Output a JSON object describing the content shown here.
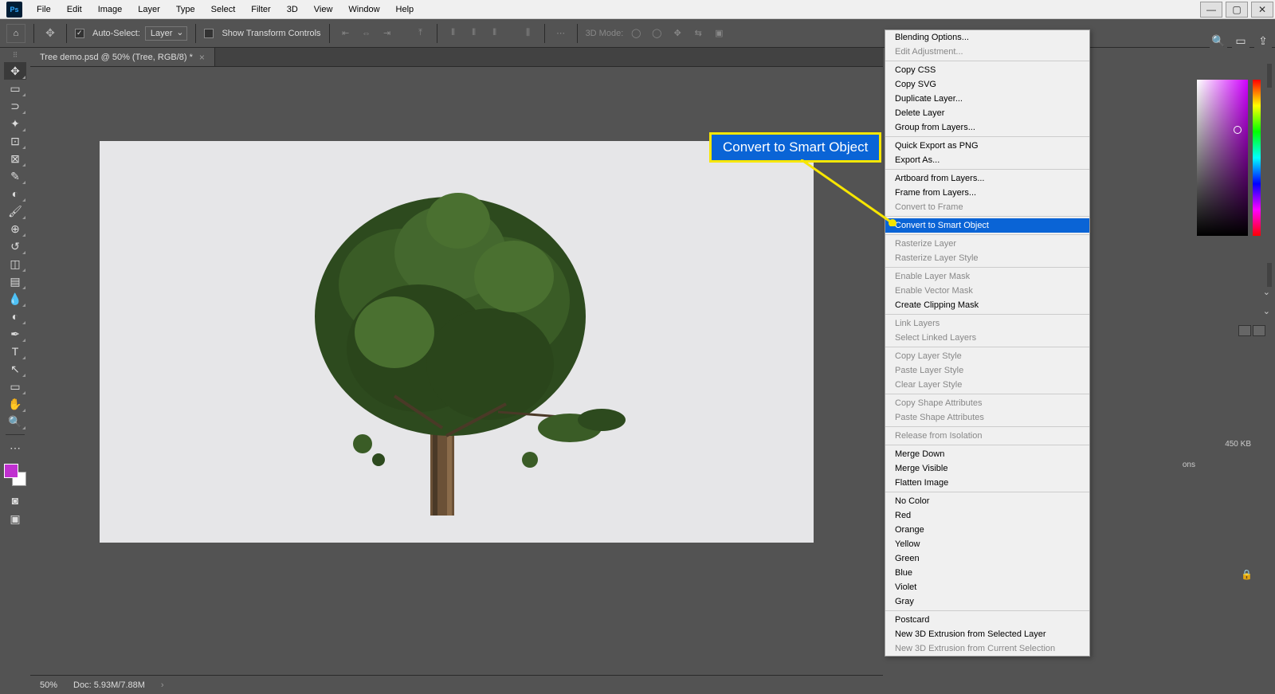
{
  "menubar": [
    "File",
    "Edit",
    "Image",
    "Layer",
    "Type",
    "Select",
    "Filter",
    "3D",
    "View",
    "Window",
    "Help"
  ],
  "options_bar": {
    "auto_select_label": "Auto-Select:",
    "auto_select_target": "Layer",
    "show_transform": "Show Transform Controls",
    "mode_3d": "3D Mode:"
  },
  "document_tab": {
    "title": "Tree demo.psd @ 50% (Tree, RGB/8) *"
  },
  "status_bar": {
    "zoom": "50%",
    "doc_info": "Doc: 5.93M/7.88M"
  },
  "context_menu": [
    {
      "label": "Blending Options...",
      "enabled": true
    },
    {
      "label": "Edit Adjustment...",
      "enabled": false
    },
    {
      "sep": true
    },
    {
      "label": "Copy CSS",
      "enabled": true
    },
    {
      "label": "Copy SVG",
      "enabled": true
    },
    {
      "label": "Duplicate Layer...",
      "enabled": true
    },
    {
      "label": "Delete Layer",
      "enabled": true
    },
    {
      "label": "Group from Layers...",
      "enabled": true
    },
    {
      "sep": true
    },
    {
      "label": "Quick Export as PNG",
      "enabled": true
    },
    {
      "label": "Export As...",
      "enabled": true
    },
    {
      "sep": true
    },
    {
      "label": "Artboard from Layers...",
      "enabled": true
    },
    {
      "label": "Frame from Layers...",
      "enabled": true
    },
    {
      "label": "Convert to Frame",
      "enabled": false
    },
    {
      "sep": true
    },
    {
      "label": "Convert to Smart Object",
      "enabled": true,
      "highlighted": true
    },
    {
      "sep": true
    },
    {
      "label": "Rasterize Layer",
      "enabled": false
    },
    {
      "label": "Rasterize Layer Style",
      "enabled": false
    },
    {
      "sep": true
    },
    {
      "label": "Enable Layer Mask",
      "enabled": false
    },
    {
      "label": "Enable Vector Mask",
      "enabled": false
    },
    {
      "label": "Create Clipping Mask",
      "enabled": true
    },
    {
      "sep": true
    },
    {
      "label": "Link Layers",
      "enabled": false
    },
    {
      "label": "Select Linked Layers",
      "enabled": false
    },
    {
      "sep": true
    },
    {
      "label": "Copy Layer Style",
      "enabled": false
    },
    {
      "label": "Paste Layer Style",
      "enabled": false
    },
    {
      "label": "Clear Layer Style",
      "enabled": false
    },
    {
      "sep": true
    },
    {
      "label": "Copy Shape Attributes",
      "enabled": false
    },
    {
      "label": "Paste Shape Attributes",
      "enabled": false
    },
    {
      "sep": true
    },
    {
      "label": "Release from Isolation",
      "enabled": false
    },
    {
      "sep": true
    },
    {
      "label": "Merge Down",
      "enabled": true
    },
    {
      "label": "Merge Visible",
      "enabled": true
    },
    {
      "label": "Flatten Image",
      "enabled": true
    },
    {
      "sep": true
    },
    {
      "label": "No Color",
      "enabled": true
    },
    {
      "label": "Red",
      "enabled": true
    },
    {
      "label": "Orange",
      "enabled": true
    },
    {
      "label": "Yellow",
      "enabled": true
    },
    {
      "label": "Green",
      "enabled": true
    },
    {
      "label": "Blue",
      "enabled": true
    },
    {
      "label": "Violet",
      "enabled": true
    },
    {
      "label": "Gray",
      "enabled": true
    },
    {
      "sep": true
    },
    {
      "label": "Postcard",
      "enabled": true
    },
    {
      "label": "New 3D Extrusion from Selected Layer",
      "enabled": true
    },
    {
      "label": "New 3D Extrusion from Current Selection",
      "enabled": false
    }
  ],
  "callout": {
    "text": "Convert to Smart Object"
  },
  "right_panel": {
    "file_size": "450 KB",
    "tab": "ons"
  },
  "tools": [
    "move",
    "marquee",
    "lasso",
    "magic-wand",
    "crop",
    "frame",
    "eyedropper",
    "healing",
    "brush",
    "clone",
    "history-brush",
    "eraser",
    "gradient",
    "blur",
    "dodge",
    "pen",
    "type",
    "path-select",
    "rectangle",
    "hand",
    "zoom"
  ],
  "app": {
    "abbr": "Ps"
  }
}
